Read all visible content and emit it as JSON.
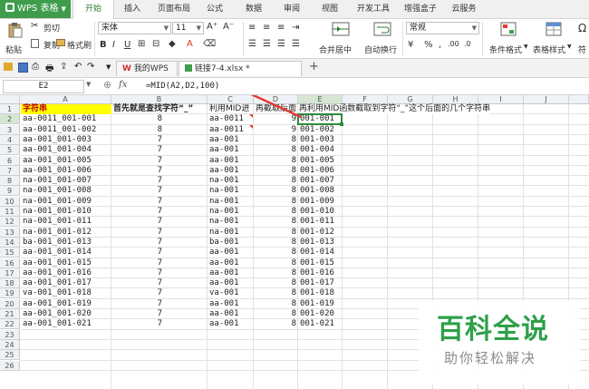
{
  "app": {
    "name": "WPS 表格"
  },
  "menu": [
    "开始",
    "插入",
    "页面布局",
    "公式",
    "数据",
    "审阅",
    "视图",
    "开发工具",
    "增强盒子",
    "云服务"
  ],
  "ribbon": {
    "paste": "粘贴",
    "cut": "剪切",
    "copy": "复制",
    "format_painter": "格式刷",
    "font_name": "宋体",
    "font_size": "11",
    "number_format": "常规",
    "merge_center": "合并居中",
    "wrap_text": "自动换行",
    "cond_format": "条件格式",
    "table_style": "表格样式",
    "symbol": "符"
  },
  "tabs": [
    {
      "label": "我的WPS"
    },
    {
      "label": "链接7-4.xlsx *"
    }
  ],
  "formula_bar": {
    "name_box": "E2",
    "fx": "fx",
    "formula": "=MID(A2,D2,100)"
  },
  "columns": [
    "A",
    "B",
    "C",
    "D",
    "E",
    "F",
    "G",
    "H",
    "I",
    "J"
  ],
  "rows": [
    "1",
    "2",
    "3",
    "4",
    "5",
    "6",
    "7",
    "8",
    "9",
    "10",
    "11",
    "12",
    "13",
    "14",
    "15",
    "16",
    "17",
    "18",
    "19",
    "20",
    "21",
    "22",
    "23",
    "24",
    "25",
    "26"
  ],
  "header_row": {
    "a": "字符串",
    "b": "首先就是查找字符“_”",
    "c": "利用MID进",
    "d": "再截取后面",
    "e": "再利用MID函数截取到字符“_”这个后面的几个字符串"
  },
  "data_rows": [
    {
      "a": "aa-0011_001-001",
      "b": "8",
      "c": "aa-0011",
      "d": "9",
      "e": "001-001"
    },
    {
      "a": "aa-0011_001-002",
      "b": "8",
      "c": "aa-0011",
      "d": "9",
      "e": "001-002"
    },
    {
      "a": "aa-001_001-003",
      "b": "7",
      "c": "aa-001",
      "d": "8",
      "e": "001-003"
    },
    {
      "a": "aa-001_001-004",
      "b": "7",
      "c": "aa-001",
      "d": "8",
      "e": "001-004"
    },
    {
      "a": "aa-001_001-005",
      "b": "7",
      "c": "aa-001",
      "d": "8",
      "e": "001-005"
    },
    {
      "a": "aa-001_001-006",
      "b": "7",
      "c": "aa-001",
      "d": "8",
      "e": "001-006"
    },
    {
      "a": "na-001_001-007",
      "b": "7",
      "c": "na-001",
      "d": "8",
      "e": "001-007"
    },
    {
      "a": "na-001_001-008",
      "b": "7",
      "c": "na-001",
      "d": "8",
      "e": "001-008"
    },
    {
      "a": "na-001_001-009",
      "b": "7",
      "c": "na-001",
      "d": "8",
      "e": "001-009"
    },
    {
      "a": "na-001_001-010",
      "b": "7",
      "c": "na-001",
      "d": "8",
      "e": "001-010"
    },
    {
      "a": "na-001_001-011",
      "b": "7",
      "c": "na-001",
      "d": "8",
      "e": "001-011"
    },
    {
      "a": "na-001_001-012",
      "b": "7",
      "c": "na-001",
      "d": "8",
      "e": "001-012"
    },
    {
      "a": "ba-001_001-013",
      "b": "7",
      "c": "ba-001",
      "d": "8",
      "e": "001-013"
    },
    {
      "a": "aa-001_001-014",
      "b": "7",
      "c": "aa-001",
      "d": "8",
      "e": "001-014"
    },
    {
      "a": "aa-001_001-015",
      "b": "7",
      "c": "aa-001",
      "d": "8",
      "e": "001-015"
    },
    {
      "a": "aa-001_001-016",
      "b": "7",
      "c": "aa-001",
      "d": "8",
      "e": "001-016"
    },
    {
      "a": "aa-001_001-017",
      "b": "7",
      "c": "aa-001",
      "d": "8",
      "e": "001-017"
    },
    {
      "a": "va-001_001-018",
      "b": "7",
      "c": "va-001",
      "d": "8",
      "e": "001-018"
    },
    {
      "a": "aa-001_001-019",
      "b": "7",
      "c": "aa-001",
      "d": "8",
      "e": "001-019"
    },
    {
      "a": "aa-001_001-020",
      "b": "7",
      "c": "aa-001",
      "d": "8",
      "e": "001-020"
    },
    {
      "a": "aa-001_001-021",
      "b": "7",
      "c": "aa-001",
      "d": "8",
      "e": "001-021"
    }
  ],
  "watermark": {
    "title": "百科全说",
    "subtitle": "助你轻松解决"
  },
  "colors": {
    "accent": "#3e9c4c",
    "header_fill": "#ffff00",
    "arrow": "#e53935",
    "selection": "#2e8b3a"
  }
}
